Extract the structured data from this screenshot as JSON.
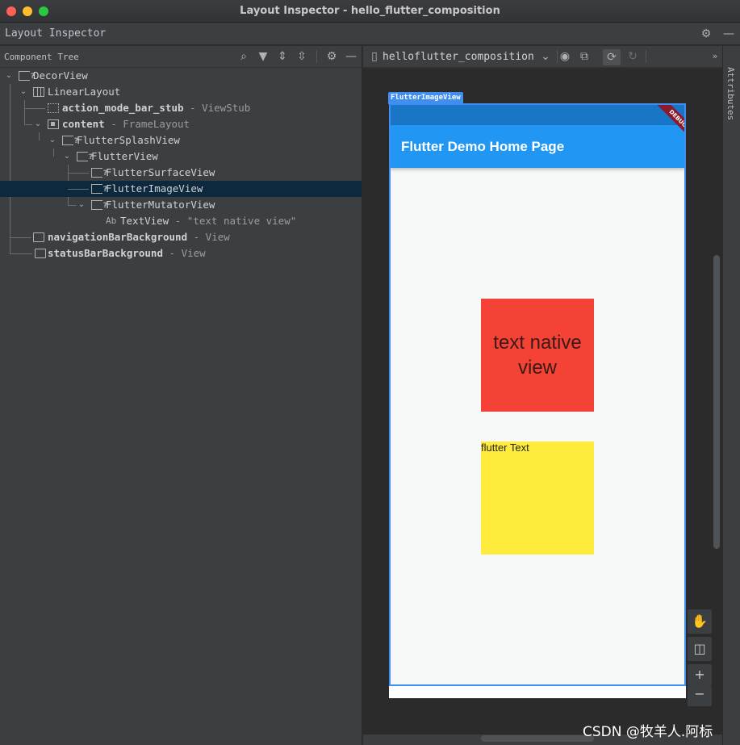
{
  "window": {
    "title": "Layout Inspector - hello_flutter_composition"
  },
  "tool_window": {
    "title": "Layout Inspector"
  },
  "component_tree": {
    "label": "Component Tree",
    "rows": [
      {
        "name": "DecorView",
        "desc": ""
      },
      {
        "name": "LinearLayout",
        "desc": ""
      },
      {
        "name": "action_mode_bar_stub",
        "desc": " - ViewStub"
      },
      {
        "name": "content",
        "desc": " - FrameLayout"
      },
      {
        "name": "FlutterSplashView",
        "desc": ""
      },
      {
        "name": "FlutterView",
        "desc": ""
      },
      {
        "name": "FlutterSurfaceView",
        "desc": ""
      },
      {
        "name": "FlutterImageView",
        "desc": ""
      },
      {
        "name": "FlutterMutatorView",
        "desc": ""
      },
      {
        "name": "TextView",
        "desc": " - \"text native view\"",
        "prefix": "Ab"
      },
      {
        "name": "navigationBarBackground",
        "desc": " - View"
      },
      {
        "name": "statusBarBackground",
        "desc": " - View"
      }
    ]
  },
  "toolbar": {
    "process": "helloflutter_composition"
  },
  "side_panel": {
    "label": "Attributes"
  },
  "device": {
    "highlight_label": "FlutterImageView",
    "app_title": "Flutter Demo Home Page",
    "debug_banner": "DEBUG",
    "native_view_text": "text native view",
    "flutter_text": "flutter Text",
    "colors": {
      "status_bar": "#1976c6",
      "app_bar": "#2196f3",
      "native_box": "#f44336",
      "flutter_box": "#ffeb3b",
      "highlight": "#3f8ef0"
    }
  },
  "watermark": "CSDN @牧羊人.阿标"
}
